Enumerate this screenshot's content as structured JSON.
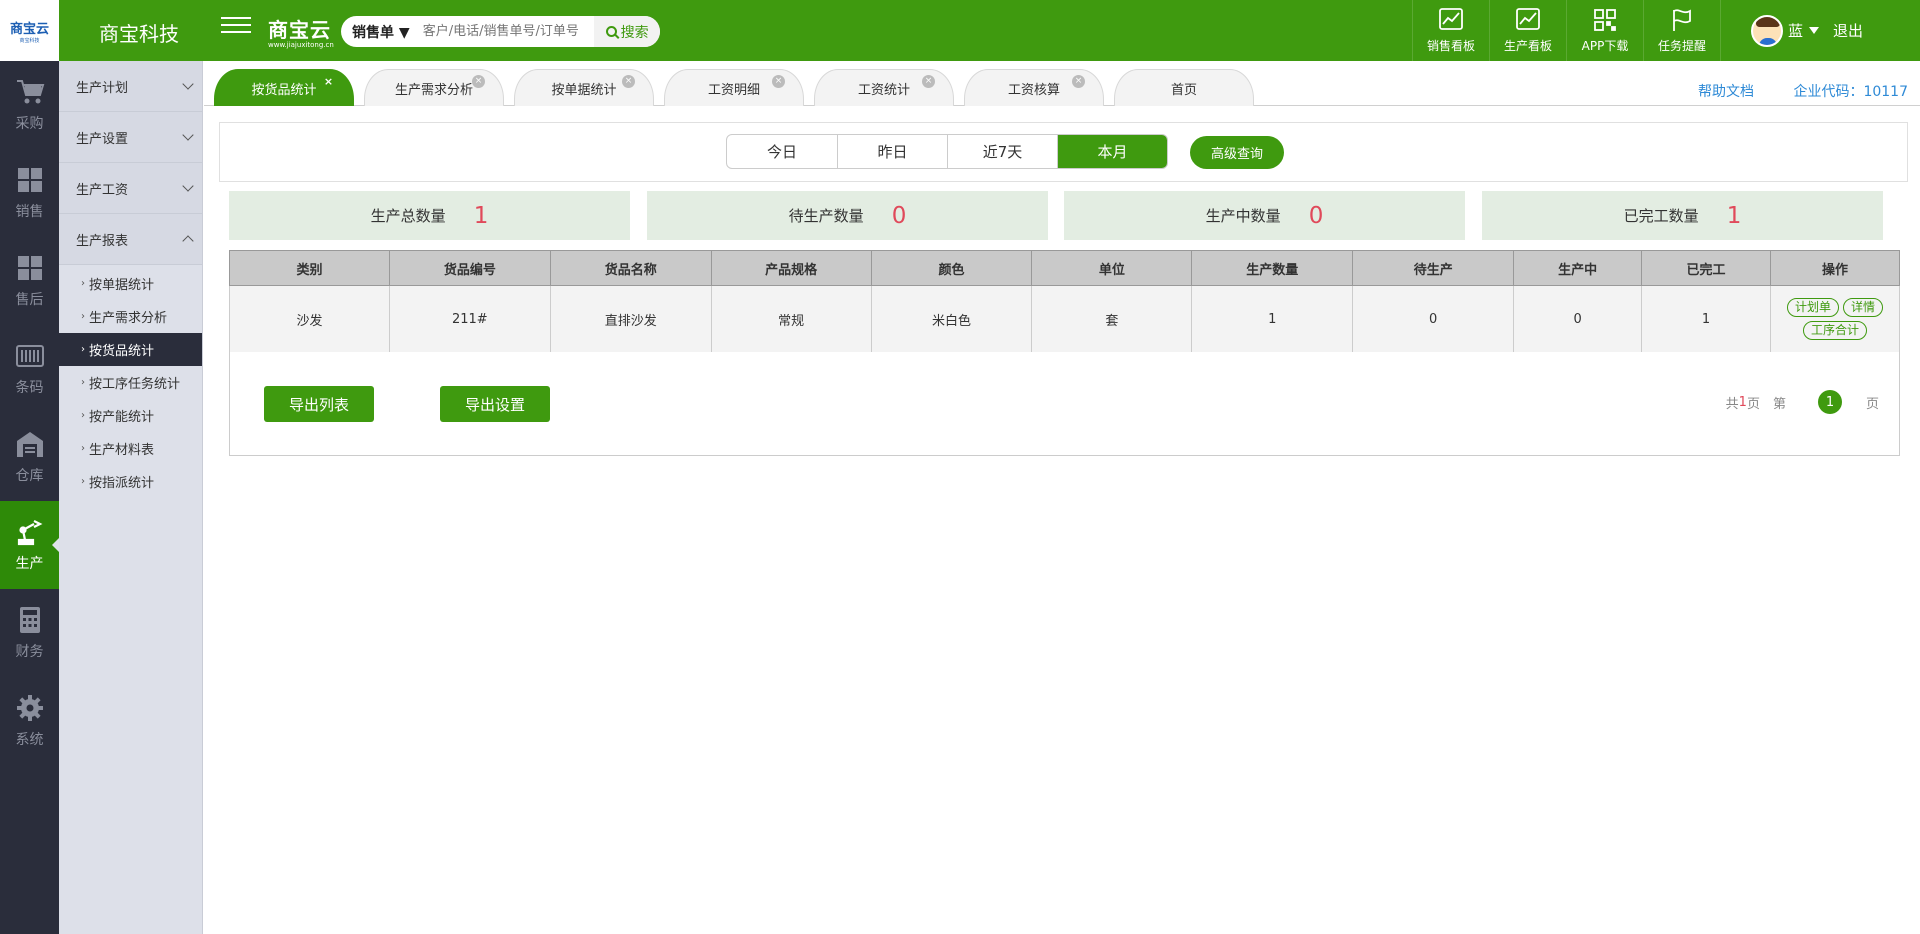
{
  "header": {
    "logo_text": "商宝云",
    "logo_sub": "商宝科技",
    "company": "商宝科技",
    "brand": "商宝云",
    "brand_url": "www.jiajuxitong.cn",
    "search_type": "销售单 ▼",
    "search_placeholder": "客户/电话/销售单号/订单号",
    "search_button": "搜索",
    "tools": [
      {
        "label": "销售看板",
        "icon": "sales-board-icon"
      },
      {
        "label": "生产看板",
        "icon": "production-board-icon"
      },
      {
        "label": "APP下载",
        "icon": "qrcode-icon"
      },
      {
        "label": "任务提醒",
        "icon": "flag-icon"
      }
    ],
    "user_name": "蓝",
    "logout": "退出"
  },
  "leftnav": [
    {
      "label": "采购",
      "icon": "cart-icon"
    },
    {
      "label": "销售",
      "icon": "boxes-icon"
    },
    {
      "label": "售后",
      "icon": "boxes-icon"
    },
    {
      "label": "条码",
      "icon": "barcode-icon"
    },
    {
      "label": "仓库",
      "icon": "warehouse-icon"
    },
    {
      "label": "生产",
      "icon": "robot-arm-icon",
      "active": true
    },
    {
      "label": "财务",
      "icon": "calculator-icon"
    },
    {
      "label": "系统",
      "icon": "gear-icon"
    }
  ],
  "subnav": {
    "groups": [
      "生产计划",
      "生产设置",
      "生产工资",
      "生产报表"
    ],
    "items": [
      "按单据统计",
      "生产需求分析",
      "按货品统计",
      "按工序任务统计",
      "按产能统计",
      "生产材料表",
      "按指派统计"
    ],
    "active_item": "按货品统计"
  },
  "tabs": [
    {
      "label": "按货品统计",
      "active": true
    },
    {
      "label": "生产需求分析"
    },
    {
      "label": "按单据统计"
    },
    {
      "label": "工资明细"
    },
    {
      "label": "工资统计"
    },
    {
      "label": "工资核算"
    },
    {
      "label": "首页"
    }
  ],
  "help_link": "帮助文档",
  "corp_code": "企业代码：10117",
  "filters": {
    "ranges": [
      "今日",
      "昨日",
      "近7天",
      "本月"
    ],
    "selected": "本月",
    "advanced": "高级查询"
  },
  "stats": [
    {
      "label": "生产总数量",
      "value": "1"
    },
    {
      "label": "待生产数量",
      "value": "0"
    },
    {
      "label": "生产中数量",
      "value": "0"
    },
    {
      "label": "已完工数量",
      "value": "1"
    }
  ],
  "table": {
    "columns": [
      "类别",
      "货品编号",
      "货品名称",
      "产品规格",
      "颜色",
      "单位",
      "生产数量",
      "待生产",
      "生产中",
      "已完工",
      "操作"
    ],
    "rows": [
      {
        "cells": [
          "沙发",
          "211#",
          "直排沙发",
          "常规",
          "米白色",
          "套",
          "1",
          "0",
          "0",
          "1"
        ],
        "actions": [
          "计划单",
          "详情",
          "工序合计"
        ]
      }
    ]
  },
  "footer": {
    "export_list": "导出列表",
    "export_settings": "导出设置",
    "pager_total_prefix": "共",
    "pager_total": "1",
    "pager_total_suffix": "页",
    "pager_page_prefix": "第",
    "pager_current": "1",
    "pager_page_suffix": "页"
  },
  "colors": {
    "brand_green": "#3f9a0f",
    "dark_nav": "#2a2d3b",
    "stat_bg": "#e3ede2",
    "stat_value": "#e0495a",
    "link_blue": "#2e8ad6"
  }
}
